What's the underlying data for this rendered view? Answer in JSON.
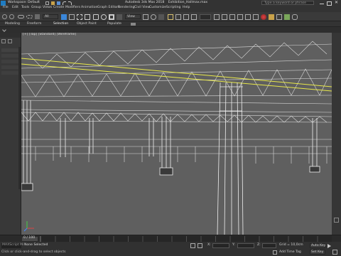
{
  "titlebar": {
    "workspace_label": "Workspace: Default",
    "title": "Autodesk 3ds Max 2018",
    "filename": "Exhibition_Hallmax.max",
    "search_placeholder": "Type a keyword or phrase"
  },
  "menubar": {
    "items": [
      "File",
      "Edit",
      "Tools",
      "Group",
      "Views",
      "Create",
      "Modifiers",
      "Animation",
      "Graph Editors",
      "Rendering",
      "Civil View",
      "Customize",
      "Scripting",
      "Help"
    ]
  },
  "toolbar": {
    "selection_filter": "All",
    "view_dropdown": "View"
  },
  "ribbon": {
    "tabs": [
      "Modeling",
      "Freeform",
      "Selection",
      "Object Paint",
      "Populate"
    ]
  },
  "viewport": {
    "label": "[+] [Top] [Standard] [Wireframe]"
  },
  "timeline": {
    "frame_display": "0 / 100",
    "ticks": [
      "0",
      "5",
      "10",
      "15",
      "20",
      "25",
      "30",
      "35",
      "40",
      "45",
      "50",
      "55",
      "60",
      "65",
      "70",
      "75",
      "80",
      "85",
      "90",
      "95",
      "100"
    ]
  },
  "statusbar": {
    "selection_status": "None Selected",
    "prompt": "Click or click-and-drag to select objects",
    "x_label": "X:",
    "x_value": "",
    "y_label": "Y:",
    "y_value": "",
    "z_label": "Z:",
    "z_value": "",
    "grid_label": "Grid = 10,0cm",
    "add_time_tag": "Add Time Tag",
    "auto_key": "Auto Key",
    "selected": "Selected",
    "set_key": "Set Key",
    "key_filters": "Key Filters...",
    "script_label": "MAXScript Mi"
  },
  "colors": {
    "accent_blue": "#3a86d8",
    "selection_yellow": "#e8e84a",
    "viewport_bg": "#5f5f5f",
    "wire_white": "#e6e6e6"
  }
}
